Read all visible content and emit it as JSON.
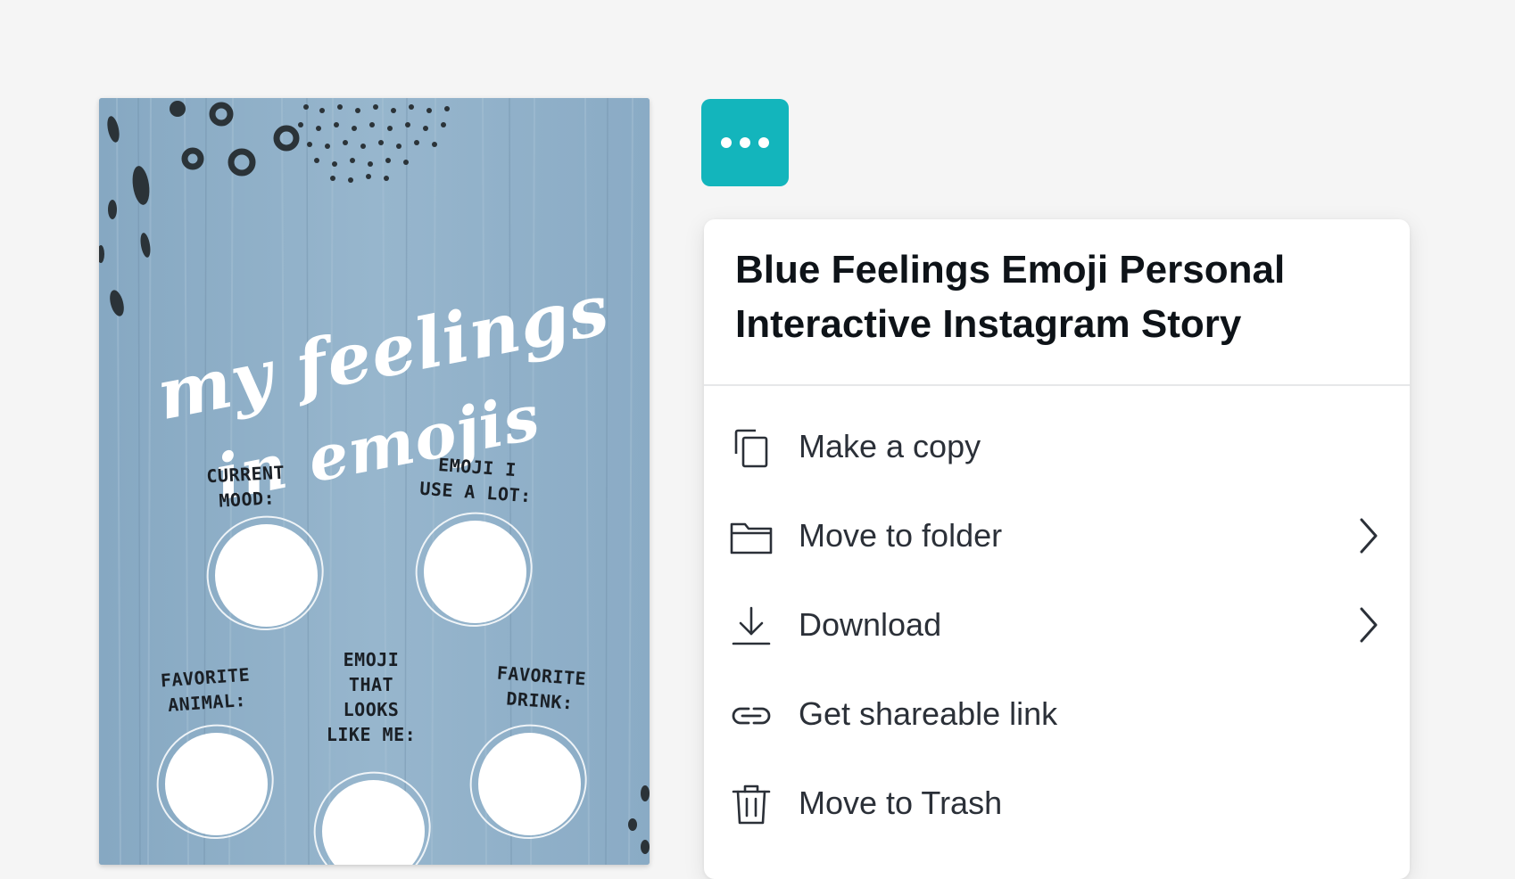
{
  "preview": {
    "title_line1": "my feelings",
    "title_line2": "in emojis",
    "prompts": {
      "current_mood": "CURRENT\nMOOD:",
      "emoji_use": "EMOJI I\nUSE A LOT:",
      "favorite_animal": "FAVORITE\nANIMAL:",
      "emoji_looks": "EMOJI\nTHAT\nLOOKS\nLIKE ME:",
      "favorite_drink": "FAVORITE\nDRINK:"
    },
    "background_color": "#8fb0c9"
  },
  "more_button": {
    "icon": "more-horizontal-icon",
    "color": "#13b5bc"
  },
  "menu": {
    "title": "Blue Feelings Emoji Personal Interactive Instagram Story",
    "items": [
      {
        "label": "Make a copy",
        "icon": "copy-icon",
        "has_submenu": false
      },
      {
        "label": "Move to folder",
        "icon": "folder-icon",
        "has_submenu": true
      },
      {
        "label": "Download",
        "icon": "download-icon",
        "has_submenu": true
      },
      {
        "label": "Get shareable link",
        "icon": "link-icon",
        "has_submenu": false
      },
      {
        "label": "Move to Trash",
        "icon": "trash-icon",
        "has_submenu": false
      }
    ]
  }
}
